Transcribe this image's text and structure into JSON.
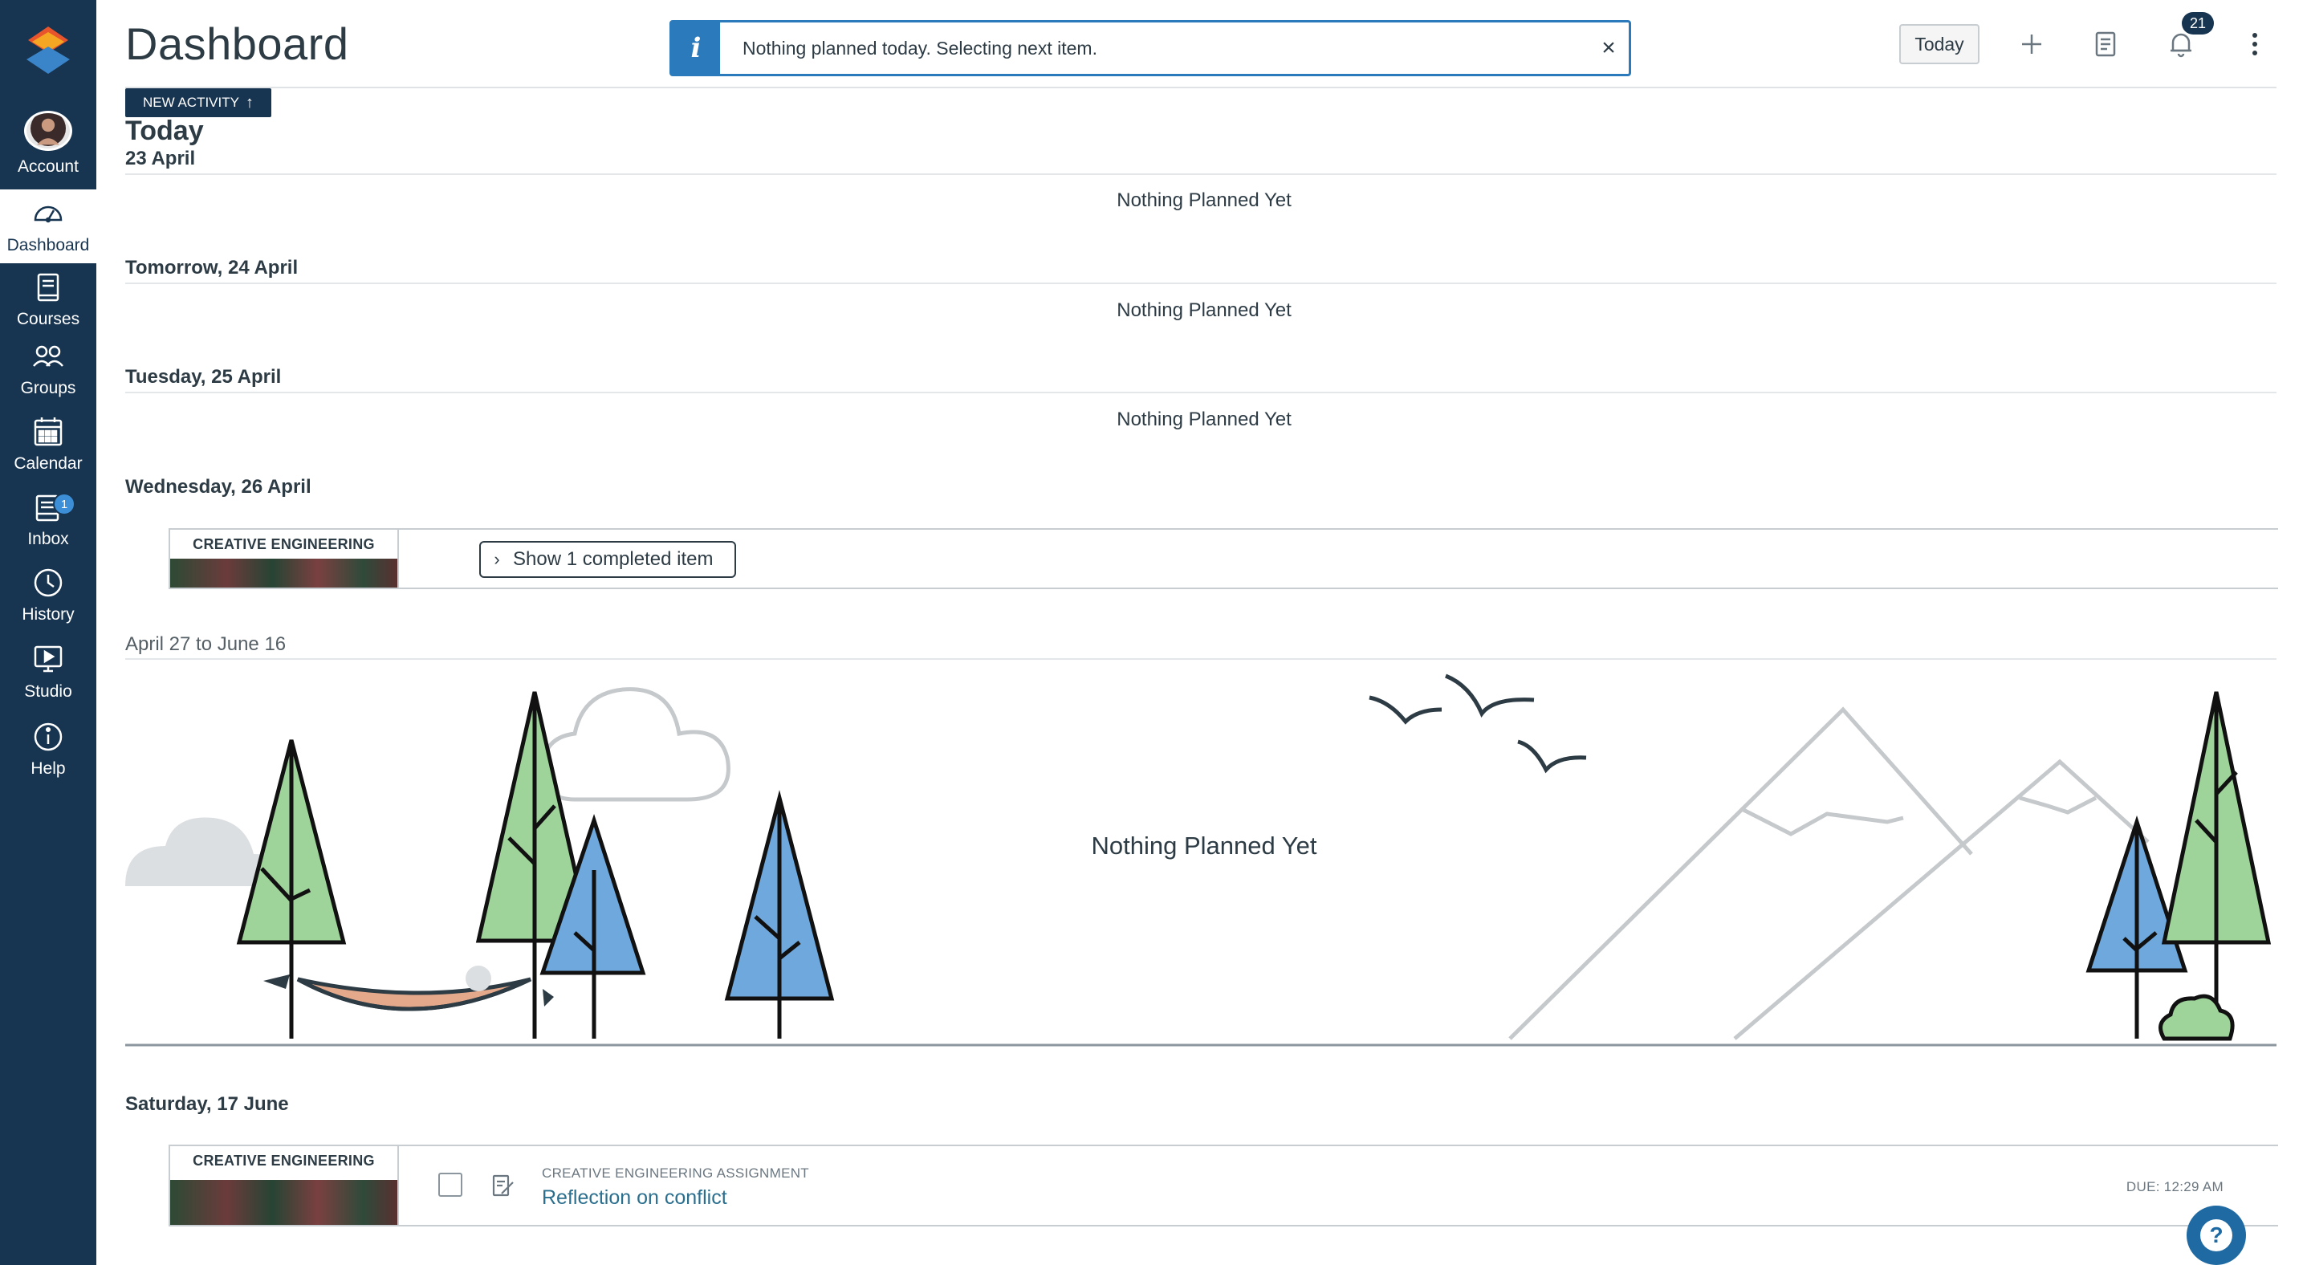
{
  "nav": {
    "items": [
      {
        "label": "Account",
        "icon": "avatar"
      },
      {
        "label": "Dashboard",
        "icon": "dashboard-icon"
      },
      {
        "label": "Courses",
        "icon": "courses-icon"
      },
      {
        "label": "Groups",
        "icon": "groups-icon"
      },
      {
        "label": "Calendar",
        "icon": "calendar-icon"
      },
      {
        "label": "Inbox",
        "icon": "inbox-icon",
        "badge": "1"
      },
      {
        "label": "History",
        "icon": "history-icon"
      },
      {
        "label": "Studio",
        "icon": "studio-icon"
      },
      {
        "label": "Help",
        "icon": "help-icon"
      }
    ],
    "active": "Dashboard"
  },
  "header": {
    "title": "Dashboard",
    "today_button": "Today",
    "notification_count": "21",
    "icons": [
      "plus-icon",
      "grade-icon",
      "bell-icon",
      "kebab-menu-icon"
    ]
  },
  "alert": {
    "text": "Nothing planned today. Selecting next item.",
    "close": "×"
  },
  "planner": {
    "new_activity": "NEW ACTIVITY",
    "days": {
      "today": {
        "title": "Today",
        "date": "23 April",
        "empty": "Nothing Planned Yet"
      },
      "tomorrow": {
        "title": "Tomorrow, 24 April",
        "empty": "Nothing Planned Yet"
      },
      "tuesday": {
        "title": "Tuesday, 25 April",
        "empty": "Nothing Planned Yet"
      },
      "wednesday": {
        "title": "Wednesday, 26 April",
        "course": "CREATIVE ENGINEERING",
        "show_completed": "Show 1 completed item"
      },
      "range": {
        "title": "April 27 to June 16",
        "empty": "Nothing Planned Yet"
      },
      "saturday": {
        "title": "Saturday, 17 June",
        "course": "CREATIVE ENGINEERING",
        "assignment_type": "CREATIVE ENGINEERING ASSIGNMENT",
        "assignment_title": "Reflection on conflict",
        "due": "DUE: 12:29 AM"
      }
    }
  },
  "colors": {
    "nav_bg": "#173450",
    "alert_accent": "#2b7abc",
    "link": "#2b6f8f",
    "tree_green": "#9ed39a",
    "tree_blue": "#6fa8dc",
    "hammock": "#e3a98a"
  }
}
